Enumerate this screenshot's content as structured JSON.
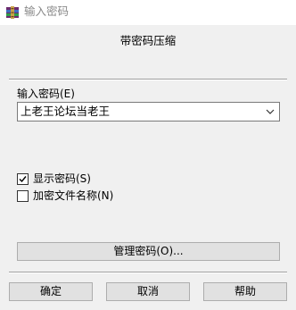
{
  "window": {
    "title": "输入密码",
    "icon": "winrar-books-icon"
  },
  "header": {
    "text": "带密码压缩"
  },
  "password": {
    "label": "输入密码(E)",
    "value": "上老王论坛当老王"
  },
  "options": {
    "show_password_label": "显示密码(S)",
    "show_password_checked": true,
    "encrypt_names_label": "加密文件名称(N)",
    "encrypt_names_checked": false
  },
  "manage_button": {
    "label": "管理密码(O)..."
  },
  "footer": {
    "ok_label": "确定",
    "cancel_label": "取消",
    "help_label": "帮助"
  }
}
